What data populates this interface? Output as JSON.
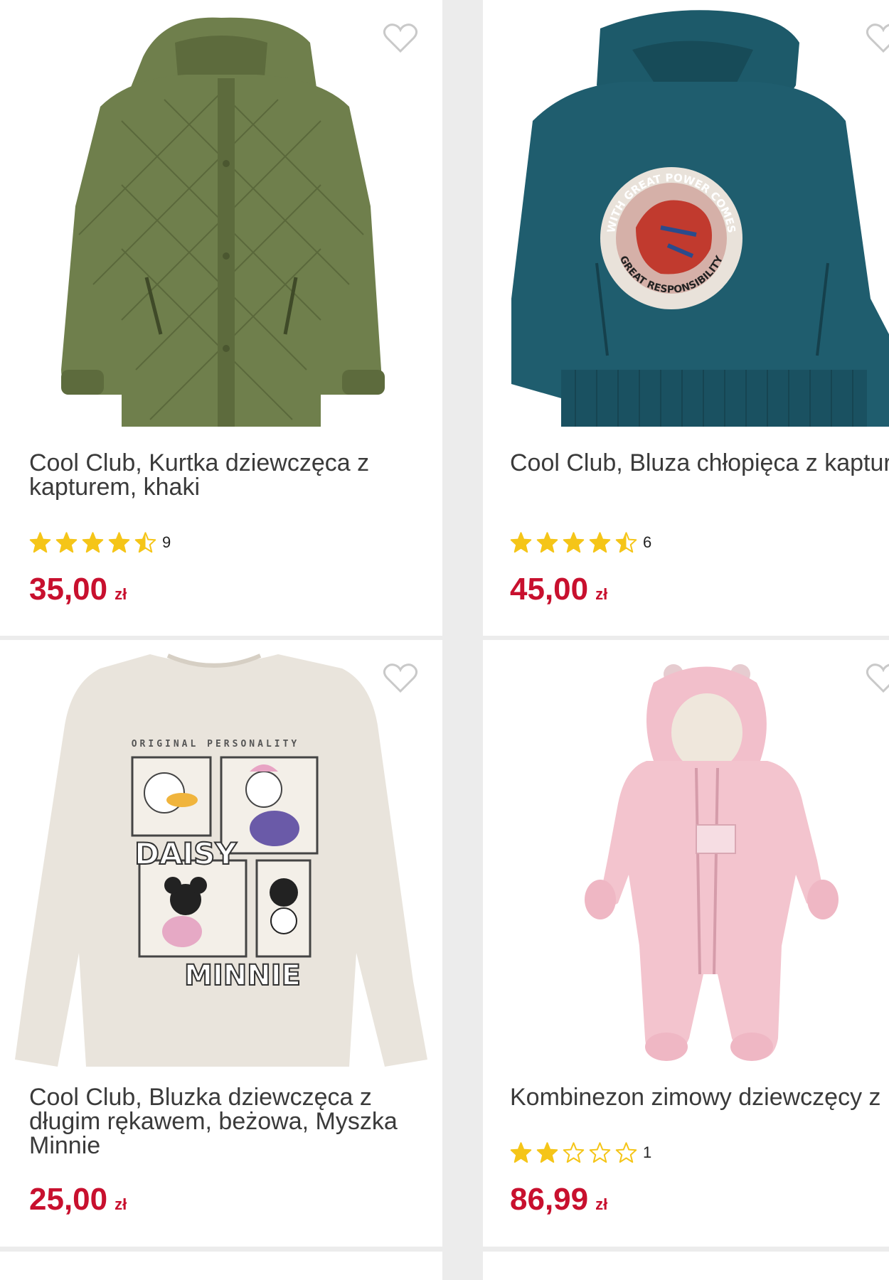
{
  "accent_color": "#c8102e",
  "star_color": "#f5c518",
  "products": [
    {
      "title": "Cool Club, Kurtka dziewczęca z\nkapturem, khaki",
      "rating_value": 4.5,
      "rating_count": "9",
      "price": "35,00",
      "currency": "zł",
      "image": "olive quilted hooded jacket"
    },
    {
      "title": "Cool Club, Bluza chłopięca z\nkapturem, granatowa, Spider-Man",
      "rating_value": 4.5,
      "rating_count": "6",
      "price": "45,00",
      "currency": "zł",
      "image": "teal hoodie with round Spider-Man print",
      "print_top": "WITH GREAT POWER COMES",
      "print_bottom": "GREAT RESPONSIBILITY"
    },
    {
      "title": "Cool Club, Bluzka dziewczęca z\ndługim rękawem, beżowa, Myszka\nMinnie",
      "price": "25,00",
      "currency": "zł",
      "image": "beige long-sleeve top with Disney comic print",
      "print_top": "ORIGINAL PERSONALITY",
      "print_word1": "DAISY",
      "print_word2": "MINNIE"
    },
    {
      "title": "Kombinezon zimowy dziewczęcy z\nkapturem, ocieplany, różowy, Kanz",
      "rating_value": 2,
      "rating_count": "1",
      "price": "86,99",
      "currency": "zł",
      "image": "pink hooded winter snowsuit"
    }
  ]
}
